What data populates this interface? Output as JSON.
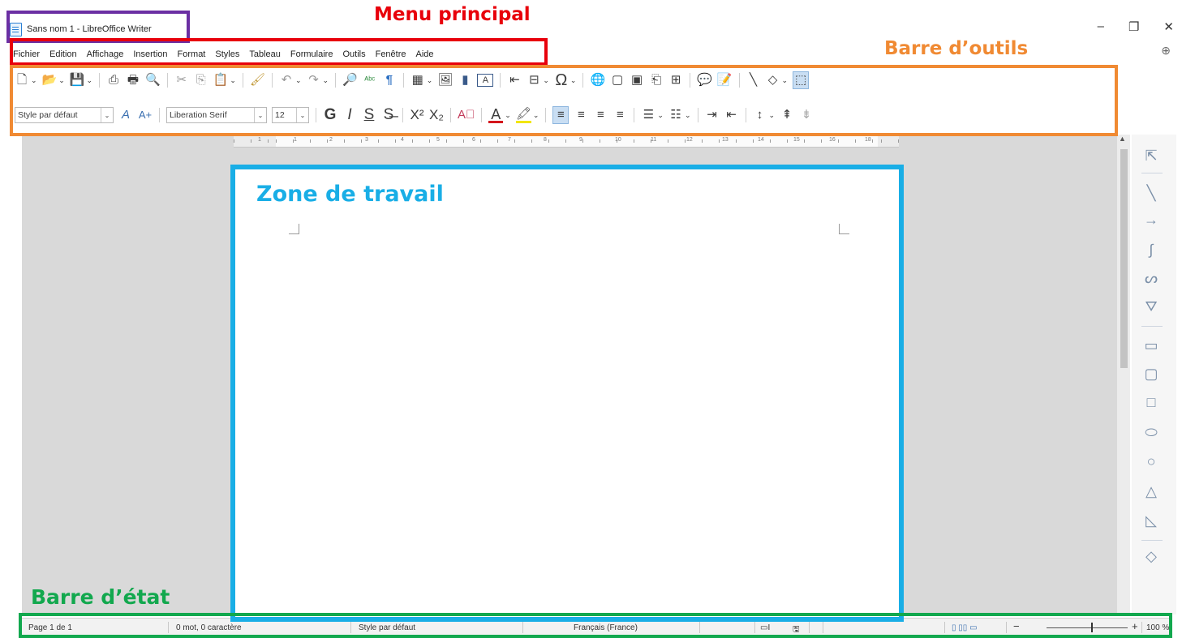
{
  "window": {
    "title": "Sans nom 1 - LibreOffice Writer",
    "minimize": "–",
    "restore": "❐",
    "close": "✕",
    "globe": "⊕"
  },
  "menu": {
    "items": [
      "Fichier",
      "Edition",
      "Affichage",
      "Insertion",
      "Format",
      "Styles",
      "Tableau",
      "Formulaire",
      "Outils",
      "Fenêtre",
      "Aide"
    ]
  },
  "toolbar": {
    "paragraph_style": "Style par défaut",
    "font_name": "Liberation Serif",
    "font_size": "12",
    "combo_arrow": "⌄",
    "icons": {
      "new": "🗋",
      "open": "📂",
      "save": "💾",
      "export_pdf": "⎙",
      "print": "🖶",
      "print_preview": "🔍",
      "cut": "✂",
      "copy": "⎘",
      "paste": "📋",
      "clone": "🖌",
      "undo": "↶",
      "redo": "↷",
      "find": "🔎",
      "spelling": "ᴬᵇᶜ",
      "formatting_marks": "¶",
      "table": "▦",
      "image": "🖼",
      "chart": "▮",
      "textbox": "A",
      "page_break": "⇤",
      "field": "⊟",
      "special_char": "Ω",
      "hyperlink": "🌐",
      "footnote": "▢",
      "endnote": "▣",
      "bookmark": "⎗",
      "cross_ref": "⊞",
      "comment": "💬",
      "track_changes": "📝",
      "line": "╲",
      "shapes": "◇",
      "draw_functions": "⬚",
      "update_style": "A",
      "new_style": "A+",
      "bold": "G",
      "italic": "I",
      "underline": "S",
      "strikethrough": "S̶",
      "superscript": "X²",
      "subscript": "X₂",
      "clear_formatting": "A⃠",
      "font_color": "A",
      "highlight": "🖍",
      "align_left": "≡",
      "align_center": "≡",
      "align_right": "≡",
      "justify": "≡",
      "bullets": "☰",
      "numbering": "☷",
      "indent_inc": "⇥",
      "indent_dec": "⇤",
      "line_spacing": "↕",
      "para_spacing_inc": "⇞",
      "para_spacing_dec": "⇟"
    }
  },
  "sidebar_draw": {
    "icons": [
      "⇱",
      "╲",
      "→",
      "∫",
      "ᔕ",
      "⛛",
      "▭",
      "▢",
      "□",
      "⬭",
      "○",
      "△",
      "◺",
      "◇"
    ]
  },
  "status": {
    "page": "Page 1 de 1",
    "words": "0 mot, 0 caractère",
    "page_style": "Style par défaut",
    "language": "Français (France)",
    "insert_mode": "▭I",
    "doc_modified": "🖫",
    "view_layout": "▯ ▯▯ ▭",
    "zoom_minus": "−",
    "zoom_plus": "+",
    "zoom": "100 %"
  },
  "annotations": {
    "menu_label": "Menu principal",
    "toolbar_label": "Barre d’outils",
    "workspace_label": "Zone de travail",
    "statusbar_label": "Barre d’état"
  },
  "ruler": {
    "numbers": [
      "1",
      "1",
      "2",
      "3",
      "4",
      "5",
      "6",
      "7",
      "8",
      "9",
      "10",
      "11",
      "12",
      "13",
      "14",
      "15",
      "16",
      "18"
    ]
  },
  "colors": {
    "title_box": "#6b2fa3",
    "menu_box": "#e8000b",
    "toolbar_box": "#f08a33",
    "workspace_box": "#19aee6",
    "status_box": "#12a84e"
  }
}
